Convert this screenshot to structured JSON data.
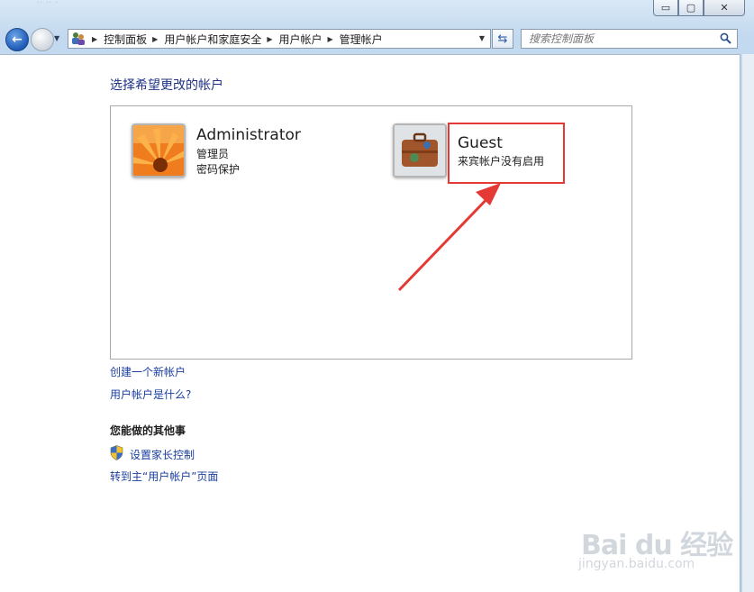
{
  "window": {
    "title_faint": "·· ·· ·",
    "buttons": {
      "minimize": "▭",
      "maximize": "▢",
      "close": "✕"
    }
  },
  "nav": {
    "breadcrumbs": [
      "控制面板",
      "用户帐户和家庭安全",
      "用户帐户",
      "管理帐户"
    ],
    "search_placeholder": "搜索控制面板"
  },
  "main": {
    "heading": "选择希望更改的帐户",
    "accounts": [
      {
        "name": "Administrator",
        "line1": "管理员",
        "line2": "密码保护"
      },
      {
        "name": "Guest",
        "line1": "来宾帐户没有启用"
      }
    ],
    "links": {
      "create_account": "创建一个新帐户",
      "what_is_account": "用户帐户是什么?"
    },
    "other_section": {
      "title": "您能做的其他事",
      "parental": "设置家长控制",
      "goto_main": "转到主“用户帐户”页面"
    }
  },
  "watermark": {
    "main": "Bai du 经验",
    "sub": "jingyan.baidu.com"
  },
  "colors": {
    "link": "#1a3ea1",
    "heading": "#1e3287",
    "annotation": "#e53935"
  }
}
